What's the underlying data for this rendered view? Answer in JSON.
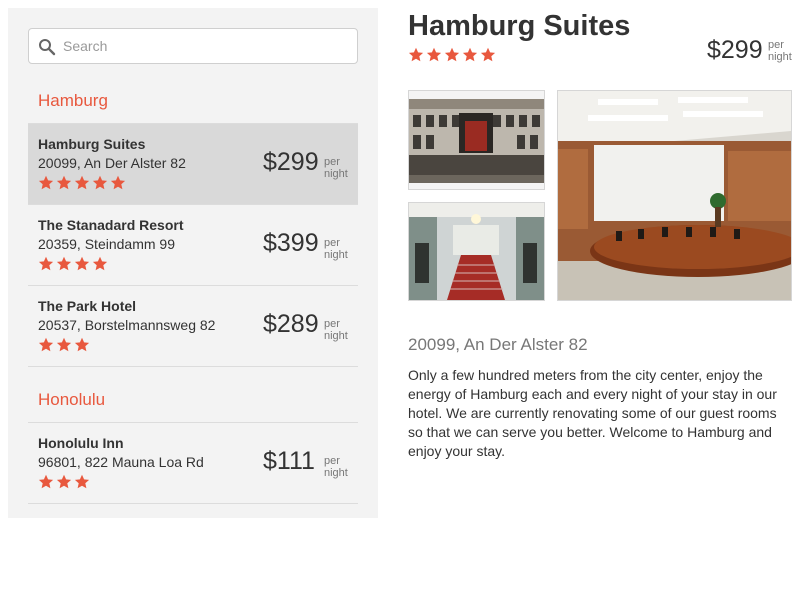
{
  "search": {
    "placeholder": "Search",
    "value": ""
  },
  "colors": {
    "accent": "#e8583e",
    "selected_bg": "#d9d9d9",
    "sidebar_bg": "#f3f3f3"
  },
  "groups": [
    {
      "city": "Hamburg",
      "hotels": [
        {
          "name": "Hamburg Suites",
          "address": "20099, An Der Alster 82",
          "price": "$299",
          "per": "per",
          "night": "night",
          "stars": 5,
          "selected": true
        },
        {
          "name": "The Stanadard Resort",
          "address": "20359, Steindamm 99",
          "price": "$399",
          "per": "per",
          "night": "night",
          "stars": 4,
          "selected": false
        },
        {
          "name": "The Park Hotel",
          "address": "20537, Borstelmannsweg 82",
          "price": "$289",
          "per": "per",
          "night": "night",
          "stars": 3,
          "selected": false
        }
      ]
    },
    {
      "city": "Honolulu",
      "hotels": [
        {
          "name": "Honolulu Inn",
          "address": "96801, 822 Mauna Loa Rd",
          "price": "$111",
          "per": "per",
          "night": "night",
          "stars": 3,
          "selected": false
        }
      ]
    }
  ],
  "detail": {
    "title": "Hamburg Suites",
    "stars": 5,
    "price": "$299",
    "per": "per",
    "night": "night",
    "address": "20099, An Der Alster 82",
    "description": "Only a few hundred meters from the city center, enjoy the energy of Hamburg each and every night of your stay in our hotel. We are currently renovating some of our guest rooms so that we can serve you better. Welcome to Hamburg and enjoy your stay."
  }
}
